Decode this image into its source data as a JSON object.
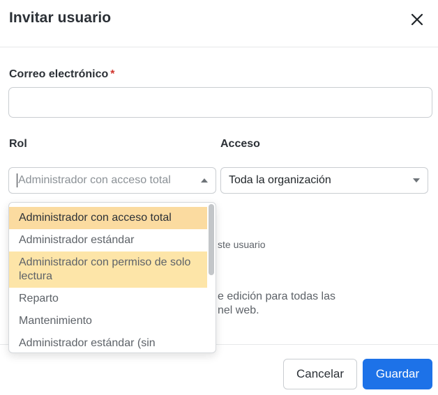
{
  "modal": {
    "title": "Invitar usuario"
  },
  "email": {
    "label": "Correo electrónico",
    "required_mark": "*",
    "value": "",
    "placeholder": ""
  },
  "role": {
    "label": "Rol",
    "placeholder": "Administrador con acceso total",
    "options": [
      {
        "label": "Administrador con acceso total",
        "state": "selected"
      },
      {
        "label": "Administrador estándar",
        "state": "normal"
      },
      {
        "label": "Administrador con permiso de solo lectura",
        "state": "hovered"
      },
      {
        "label": "Reparto",
        "state": "normal"
      },
      {
        "label": "Mantenimiento",
        "state": "normal"
      },
      {
        "label": "Administrador estándar (sin",
        "state": "normal"
      }
    ]
  },
  "access": {
    "label": "Acceso",
    "value": "Toda la organización"
  },
  "background_text": {
    "line1": "ste usuario",
    "line2": "e edición para todas las",
    "line3": "nel web."
  },
  "footer": {
    "cancel_label": "Cancelar",
    "save_label": "Guardar"
  },
  "colors": {
    "primary": "#1d72e8",
    "selected_option": "#fbdba0",
    "required": "#d0342c"
  },
  "icons": {
    "close": "close-icon",
    "role_caret": "caret-up-icon",
    "access_caret": "caret-down-icon"
  }
}
